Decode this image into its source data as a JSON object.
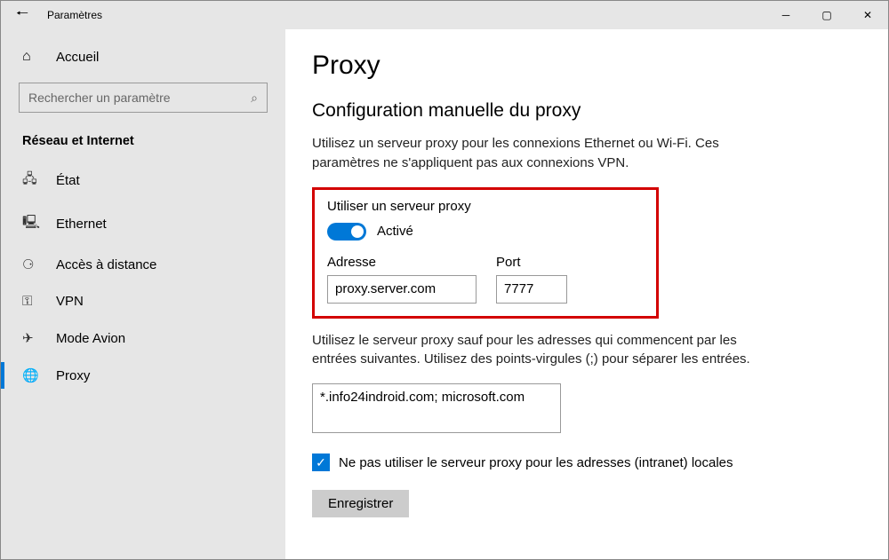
{
  "window": {
    "title": "Paramètres"
  },
  "sidebar": {
    "home": "Accueil",
    "searchPlaceholder": "Rechercher un paramètre",
    "group": "Réseau et Internet",
    "items": [
      {
        "label": "État"
      },
      {
        "label": "Ethernet"
      },
      {
        "label": "Accès à distance"
      },
      {
        "label": "VPN"
      },
      {
        "label": "Mode Avion"
      },
      {
        "label": "Proxy"
      }
    ]
  },
  "main": {
    "title": "Proxy",
    "section": "Configuration manuelle du proxy",
    "desc1": "Utilisez un serveur proxy pour les connexions Ethernet ou Wi-Fi. Ces paramètres ne s'appliquent pas aux connexions VPN.",
    "useProxyLabel": "Utiliser un serveur proxy",
    "toggleState": "Activé",
    "addressLabel": "Adresse",
    "addressValue": "proxy.server.com",
    "portLabel": "Port",
    "portValue": "7777",
    "desc2": "Utilisez le serveur proxy sauf pour les adresses qui commencent par les entrées suivantes. Utilisez des points-virgules (;) pour séparer les entrées.",
    "exceptions": "*.info24indroid.com; microsoft.com",
    "checkboxLabel": "Ne pas utiliser le serveur proxy pour les adresses (intranet) locales",
    "saveLabel": "Enregistrer"
  }
}
